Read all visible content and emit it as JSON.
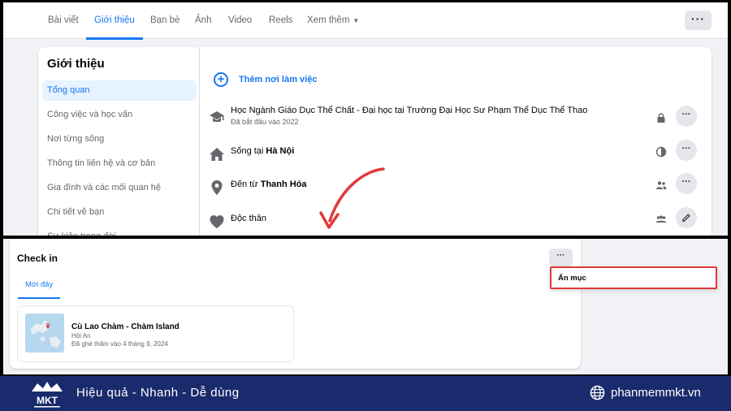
{
  "tabs": {
    "items": [
      {
        "label": "Bài viết"
      },
      {
        "label": "Giới thiệu"
      },
      {
        "label": "Bạn bè"
      },
      {
        "label": "Ảnh"
      },
      {
        "label": "Video"
      },
      {
        "label": "Reels"
      },
      {
        "label": "Xem thêm"
      }
    ],
    "more_button": "···"
  },
  "about": {
    "title": "Giới thiệu",
    "sidebar": [
      {
        "label": "Tổng quan"
      },
      {
        "label": "Công việc và học vấn"
      },
      {
        "label": "Nơi từng sống"
      },
      {
        "label": "Thông tin liên hệ và cơ bản"
      },
      {
        "label": "Gia đình và các mối quan hệ"
      },
      {
        "label": "Chi tiết về bạn"
      },
      {
        "label": "Sự kiện trong đời"
      }
    ],
    "add_work": "Thêm nơi làm việc",
    "rows": [
      {
        "text": "Học Ngành Giáo Dục Thể Chất - Đại học tại Trường Đại Học Sư Phạm Thể Dục Thể Thao",
        "sub": "Đã bắt đầu vào 2022"
      },
      {
        "prefix": "Sống tại ",
        "bold": "Hà Nội"
      },
      {
        "prefix": "Đến từ ",
        "bold": "Thanh Hóa"
      },
      {
        "text": "Độc thân"
      }
    ],
    "row_button": "···"
  },
  "checkin": {
    "title": "Check in",
    "menu_button": "···",
    "tab": "Mới đây",
    "place": {
      "name": "Cù Lao Chàm - Chàm Island",
      "city": "Hội An",
      "visited": "Đã ghé thăm vào 4 tháng 9, 2024"
    },
    "hide_option": "Ẩn mục"
  },
  "footer": {
    "slogan": "Hiệu quả - Nhanh - Dễ dùng",
    "site": "phanmemmkt.vn",
    "logo_text": "MKT"
  },
  "colors": {
    "accent": "#1877f2",
    "footer_bg": "#1a2b6d",
    "highlight_border": "#e0393a",
    "arrow": "#e0393a"
  }
}
